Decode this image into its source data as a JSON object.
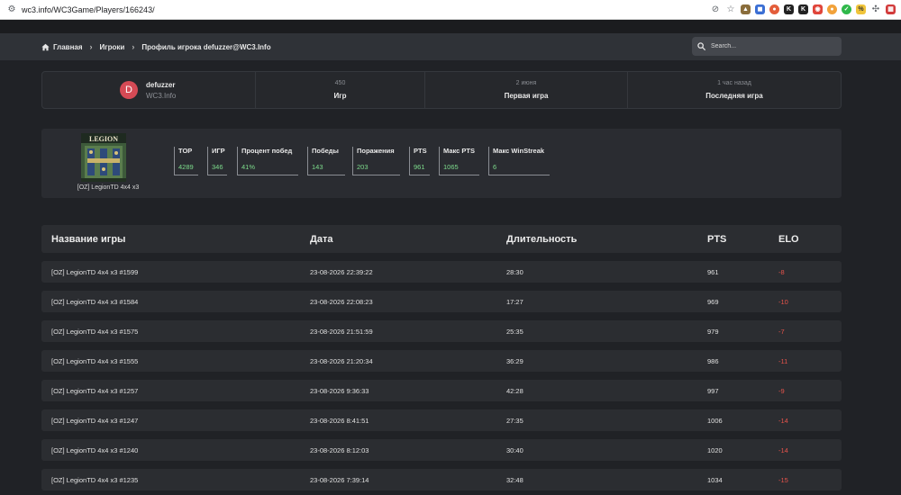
{
  "browser": {
    "url": "wc3.info/WC3Game/Players/166243/"
  },
  "nav": {
    "breadcrumb": [
      "Главная",
      "Игроки",
      "Профиль игрока defuzzer@WC3.Info"
    ],
    "search_placeholder": "Search..."
  },
  "profile": {
    "avatar_letter": "D",
    "name": "defuzzer",
    "site": "WC3.Info",
    "stats": [
      {
        "value": "450",
        "label": "Игр"
      },
      {
        "value": "2 июня",
        "label": "Первая игра"
      },
      {
        "value": "1 час назад",
        "label": "Последняя игра"
      }
    ]
  },
  "game": {
    "logo_text": "LEGION",
    "name": "[OZ] LegionTD 4x4 x3",
    "stats": [
      {
        "label": "TOP",
        "value": "4289"
      },
      {
        "label": "ИГР",
        "value": "346"
      },
      {
        "label": "Процент побед",
        "value": "41%"
      },
      {
        "label": "Победы",
        "value": "143"
      },
      {
        "label": "Поражения",
        "value": "203"
      },
      {
        "label": "PTS",
        "value": "961"
      },
      {
        "label": "Макс PTS",
        "value": "1065"
      },
      {
        "label": "Макс WinStreak",
        "value": "6"
      }
    ]
  },
  "table": {
    "headers": [
      "Название игры",
      "Дата",
      "Длительность",
      "PTS",
      "ELO"
    ],
    "rows": [
      [
        "[OZ] LegionTD 4x4 x3 #1599",
        "23-08-2026 22:39:22",
        "28:30",
        "961",
        "-8"
      ],
      [
        "[OZ] LegionTD 4x4 x3 #1584",
        "23-08-2026 22:08:23",
        "17:27",
        "969",
        "-10"
      ],
      [
        "[OZ] LegionTD 4x4 x3 #1575",
        "23-08-2026 21:51:59",
        "25:35",
        "979",
        "-7"
      ],
      [
        "[OZ] LegionTD 4x4 x3 #1555",
        "23-08-2026 21:20:34",
        "36:29",
        "986",
        "-11"
      ],
      [
        "[OZ] LegionTD 4x4 x3 #1257",
        "23-08-2026 9:36:33",
        "42:28",
        "997",
        "-9"
      ],
      [
        "[OZ] LegionTD 4x4 x3 #1247",
        "23-08-2026 8:41:51",
        "27:35",
        "1006",
        "-14"
      ],
      [
        "[OZ] LegionTD 4x4 x3 #1240",
        "23-08-2026 8:12:03",
        "30:40",
        "1020",
        "-14"
      ],
      [
        "[OZ] LegionTD 4x4 x3 #1235",
        "23-08-2026 7:39:14",
        "32:48",
        "1034",
        "-15"
      ]
    ]
  }
}
